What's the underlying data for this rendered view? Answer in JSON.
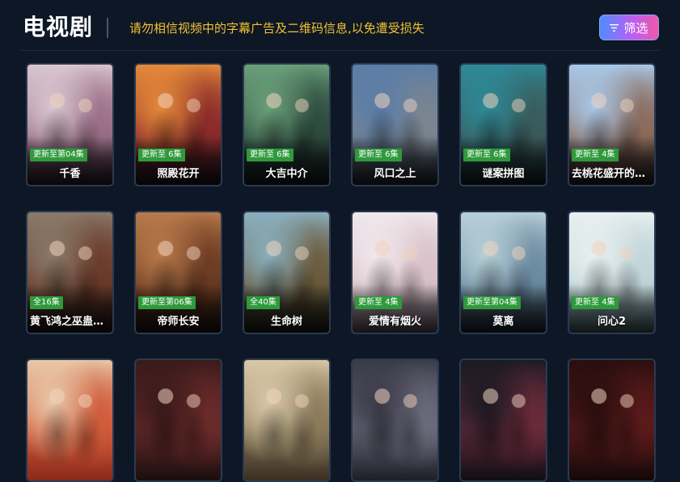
{
  "header": {
    "title": "电视剧",
    "notice": "请勿相信视频中的字幕广告及二维码信息,以免遭受损失",
    "filter_label": "筛选"
  },
  "cards": [
    {
      "title": "千香",
      "badge": "更新至第04集",
      "colors": [
        "#d9c6cf",
        "#9a6e88",
        "#3e2a3e"
      ]
    },
    {
      "title": "照殿花开",
      "badge": "更新至 6集",
      "colors": [
        "#e58a3a",
        "#8a2a2a",
        "#2a1a22"
      ]
    },
    {
      "title": "大吉中介",
      "badge": "更新至 6集",
      "colors": [
        "#6aa07a",
        "#2d4a3e",
        "#1a2628"
      ]
    },
    {
      "title": "风口之上",
      "badge": "更新至 6集",
      "colors": [
        "#5a7da8",
        "#7a8590",
        "#2b3542"
      ]
    },
    {
      "title": "谜案拼图",
      "badge": "更新至 6集",
      "colors": [
        "#2d8a98",
        "#3a5a5a",
        "#1e2e38"
      ]
    },
    {
      "title": "去桃花盛开的地方",
      "badge": "更新至 4集",
      "colors": [
        "#a9c8e8",
        "#8a6a5a",
        "#3a2a2a"
      ]
    },
    {
      "title": "黄飞鸿之巫蛊邪灵",
      "badge": "全16集",
      "colors": [
        "#8a7a6a",
        "#6a3a2a",
        "#2a1e1a"
      ]
    },
    {
      "title": "帝师长安",
      "badge": "更新至第06集",
      "colors": [
        "#b87a4a",
        "#6a3a22",
        "#2a1a14"
      ]
    },
    {
      "title": "生命树",
      "badge": "全40集",
      "colors": [
        "#8ab0c0",
        "#6a5a3a",
        "#2a2a22"
      ]
    },
    {
      "title": "爱情有烟火",
      "badge": "更新至 4集",
      "colors": [
        "#f0e8ec",
        "#d8c0c8",
        "#8a7a88"
      ]
    },
    {
      "title": "莫离",
      "badge": "更新至第04集",
      "colors": [
        "#b8d0d8",
        "#6a8aa0",
        "#2a3a48"
      ]
    },
    {
      "title": "问心2",
      "badge": "更新至 4集",
      "colors": [
        "#e8f0f0",
        "#c0d4d8",
        "#6a8a92"
      ]
    },
    {
      "title": "",
      "badge": "",
      "colors": [
        "#e8c8a8",
        "#d05a3a",
        "#8a2a1a"
      ]
    },
    {
      "title": "",
      "badge": "",
      "colors": [
        "#3a1a1a",
        "#6a2a2a",
        "#1a0e0e"
      ]
    },
    {
      "title": "",
      "badge": "",
      "colors": [
        "#d8c8a8",
        "#8a7a5a",
        "#3a2e22"
      ]
    },
    {
      "title": "",
      "badge": "",
      "colors": [
        "#3a3a48",
        "#6a6a7a",
        "#1e1e28"
      ]
    },
    {
      "title": "",
      "badge": "",
      "colors": [
        "#1a1a22",
        "#6a2a3a",
        "#0e0e14"
      ]
    },
    {
      "title": "",
      "badge": "",
      "colors": [
        "#2a0e0e",
        "#5a1a1a",
        "#140808"
      ]
    }
  ]
}
